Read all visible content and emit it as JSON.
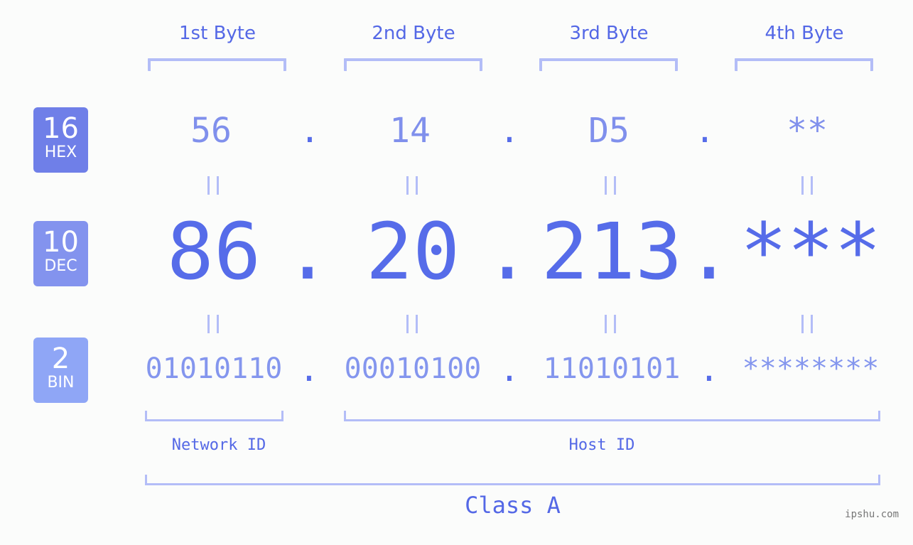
{
  "bytes": {
    "headers": [
      "1st Byte",
      "2nd Byte",
      "3rd Byte",
      "4th Byte"
    ]
  },
  "badges": {
    "hex": {
      "num": "16",
      "label": "HEX",
      "color": "#6f7fe8"
    },
    "dec": {
      "num": "10",
      "label": "DEC",
      "color": "#8393ee"
    },
    "bin": {
      "num": "2",
      "label": "BIN",
      "color": "#8fa6f6"
    }
  },
  "hex_values": [
    "56",
    "14",
    "D5",
    "**"
  ],
  "dec_values": [
    "86",
    "20",
    "213",
    "***"
  ],
  "bin_values": [
    "01010110",
    "00010100",
    "11010101",
    "********"
  ],
  "separator": ".",
  "equals_sign": "=",
  "labels": {
    "network_id": "Network ID",
    "host_id": "Host ID",
    "class": "Class A"
  },
  "credit": "ipshu.com",
  "colors": {
    "accent": "#566ce9",
    "bracket": "#b3bdf7",
    "background": "#fbfcfb"
  }
}
